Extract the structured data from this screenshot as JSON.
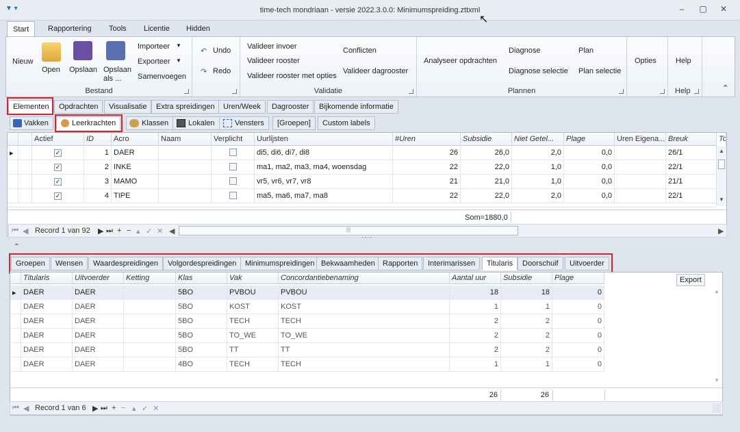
{
  "window": {
    "title": "time-tech mondriaan - versie 2022.3.0.0: Minimumspreiding.zttxml",
    "minimize": "–",
    "restore": "▢",
    "close": "✕",
    "qat": "▼  ▾"
  },
  "ribbon_tabs": [
    "Start",
    "Rapportering",
    "Tools",
    "Licentie",
    "Hidden"
  ],
  "ribbon": {
    "bestand": {
      "label": "Bestand",
      "nieuw": "Nieuw",
      "open": "Open",
      "opslaan": "Opslaan",
      "opslaan_als": "Opslaan als ...",
      "importeer": "Importeer",
      "exporteer": "Exporteer",
      "samenvoegen": "Samenvoegen"
    },
    "undo": "Undo",
    "redo": "Redo",
    "validatie": {
      "label": "Validatie",
      "invoer": "Valideer invoer",
      "rooster": "Valideer rooster",
      "rooster_opties": "Valideer rooster met opties",
      "conflicten": "Conflicten",
      "dagrooster": "Valideer dagrooster"
    },
    "plannen": {
      "label": "Plannen",
      "analyseer": "Analyseer opdrachten",
      "diagnose": "Diagnose",
      "diagnose_sel": "Diagnose selectie",
      "plan": "Plan",
      "plan_sel": "Plan selectie"
    },
    "opties": "Opties",
    "help": {
      "label": "Help",
      "btn": "Help"
    },
    "collapse": "⌃"
  },
  "main_tabs": [
    "Elementen",
    "Opdrachten",
    "Visualisatie",
    "Extra spreidingen",
    "Uren/Week",
    "Dagrooster",
    "Bijkomende informatie"
  ],
  "element_tabs": [
    "Vakken",
    "Leerkrachten",
    "Klassen",
    "Lokalen",
    "Vensters",
    "[Groepen]",
    "Custom labels"
  ],
  "top_grid": {
    "columns": [
      "Actief",
      "ID",
      "Acro",
      "Naam",
      "Verplicht",
      "Uurlijsten",
      "#Uren",
      "Subsidie",
      "Niet Getel...",
      "Plage",
      "Uren Eigena...",
      "Breuk",
      "To"
    ],
    "rows": [
      {
        "actief": "✓",
        "id": "1",
        "acro": "DAER",
        "naam": "",
        "verplicht": "",
        "uurlijsten": "di5, di6, di7, di8",
        "uren": "26",
        "subsidie": "26,0",
        "niet": "2,0",
        "plage": "0,0",
        "eigen": "",
        "breuk": "26/1"
      },
      {
        "actief": "✓",
        "id": "2",
        "acro": "INKE",
        "naam": "",
        "verplicht": "",
        "uurlijsten": "ma1, ma2, ma3, ma4, woensdag",
        "uren": "22",
        "subsidie": "22,0",
        "niet": "1,0",
        "plage": "0,0",
        "eigen": "",
        "breuk": "22/1"
      },
      {
        "actief": "✓",
        "id": "3",
        "acro": "MAMO",
        "naam": "",
        "verplicht": "",
        "uurlijsten": "vr5, vr6, vr7, vr8",
        "uren": "21",
        "subsidie": "21,0",
        "niet": "1,0",
        "plage": "0,0",
        "eigen": "",
        "breuk": "21/1"
      },
      {
        "actief": "✓",
        "id": "4",
        "acro": "TIPE",
        "naam": "",
        "verplicht": "",
        "uurlijsten": "ma5, ma6, ma7, ma8",
        "uren": "22",
        "subsidie": "22,0",
        "niet": "2,0",
        "plage": "0,0",
        "eigen": "",
        "breuk": "22/1"
      }
    ],
    "sum": "Som=1880,0",
    "record": "Record 1 van 92"
  },
  "detail_tabs": [
    "Groepen",
    "Wensen",
    "Waardespreidingen",
    "Volgordespreidingen",
    "Minimumspreidingen",
    "Bekwaamheden",
    "Rapporten",
    "Interimarissen",
    "Titularis",
    "Doorschuif",
    "Uitvoerder"
  ],
  "bottom_grid": {
    "columns": [
      "Titularis",
      "Uitvoerder",
      "Ketting",
      "Klas",
      "Vak",
      "Concordantiebenaming",
      "Aantal uur",
      "Subsidie",
      "Plage"
    ],
    "rows": [
      {
        "tit": "DAER",
        "uit": "DAER",
        "ket": "",
        "klas": "5BO",
        "vak": "PVBOU",
        "conc": "PVBOU",
        "aantal": "18",
        "sub": "18",
        "plage": "0"
      },
      {
        "tit": "DAER",
        "uit": "DAER",
        "ket": "",
        "klas": "5BO",
        "vak": "KOST",
        "conc": "KOST",
        "aantal": "1",
        "sub": "1",
        "plage": "0"
      },
      {
        "tit": "DAER",
        "uit": "DAER",
        "ket": "",
        "klas": "5BO",
        "vak": "TECH",
        "conc": "TECH",
        "aantal": "2",
        "sub": "2",
        "plage": "0"
      },
      {
        "tit": "DAER",
        "uit": "DAER",
        "ket": "",
        "klas": "5BO",
        "vak": "TO_WE",
        "conc": "TO_WE",
        "aantal": "2",
        "sub": "2",
        "plage": "0"
      },
      {
        "tit": "DAER",
        "uit": "DAER",
        "ket": "",
        "klas": "5BO",
        "vak": "TT",
        "conc": "TT",
        "aantal": "2",
        "sub": "2",
        "plage": "0"
      },
      {
        "tit": "DAER",
        "uit": "DAER",
        "ket": "",
        "klas": "4BO",
        "vak": "TECH",
        "conc": "TECH",
        "aantal": "1",
        "sub": "1",
        "plage": "0"
      }
    ],
    "sum_aantal": "26",
    "sum_sub": "26",
    "record": "Record 1 van 6",
    "export": "Export"
  },
  "colors": {
    "accent": "#d8232a"
  }
}
